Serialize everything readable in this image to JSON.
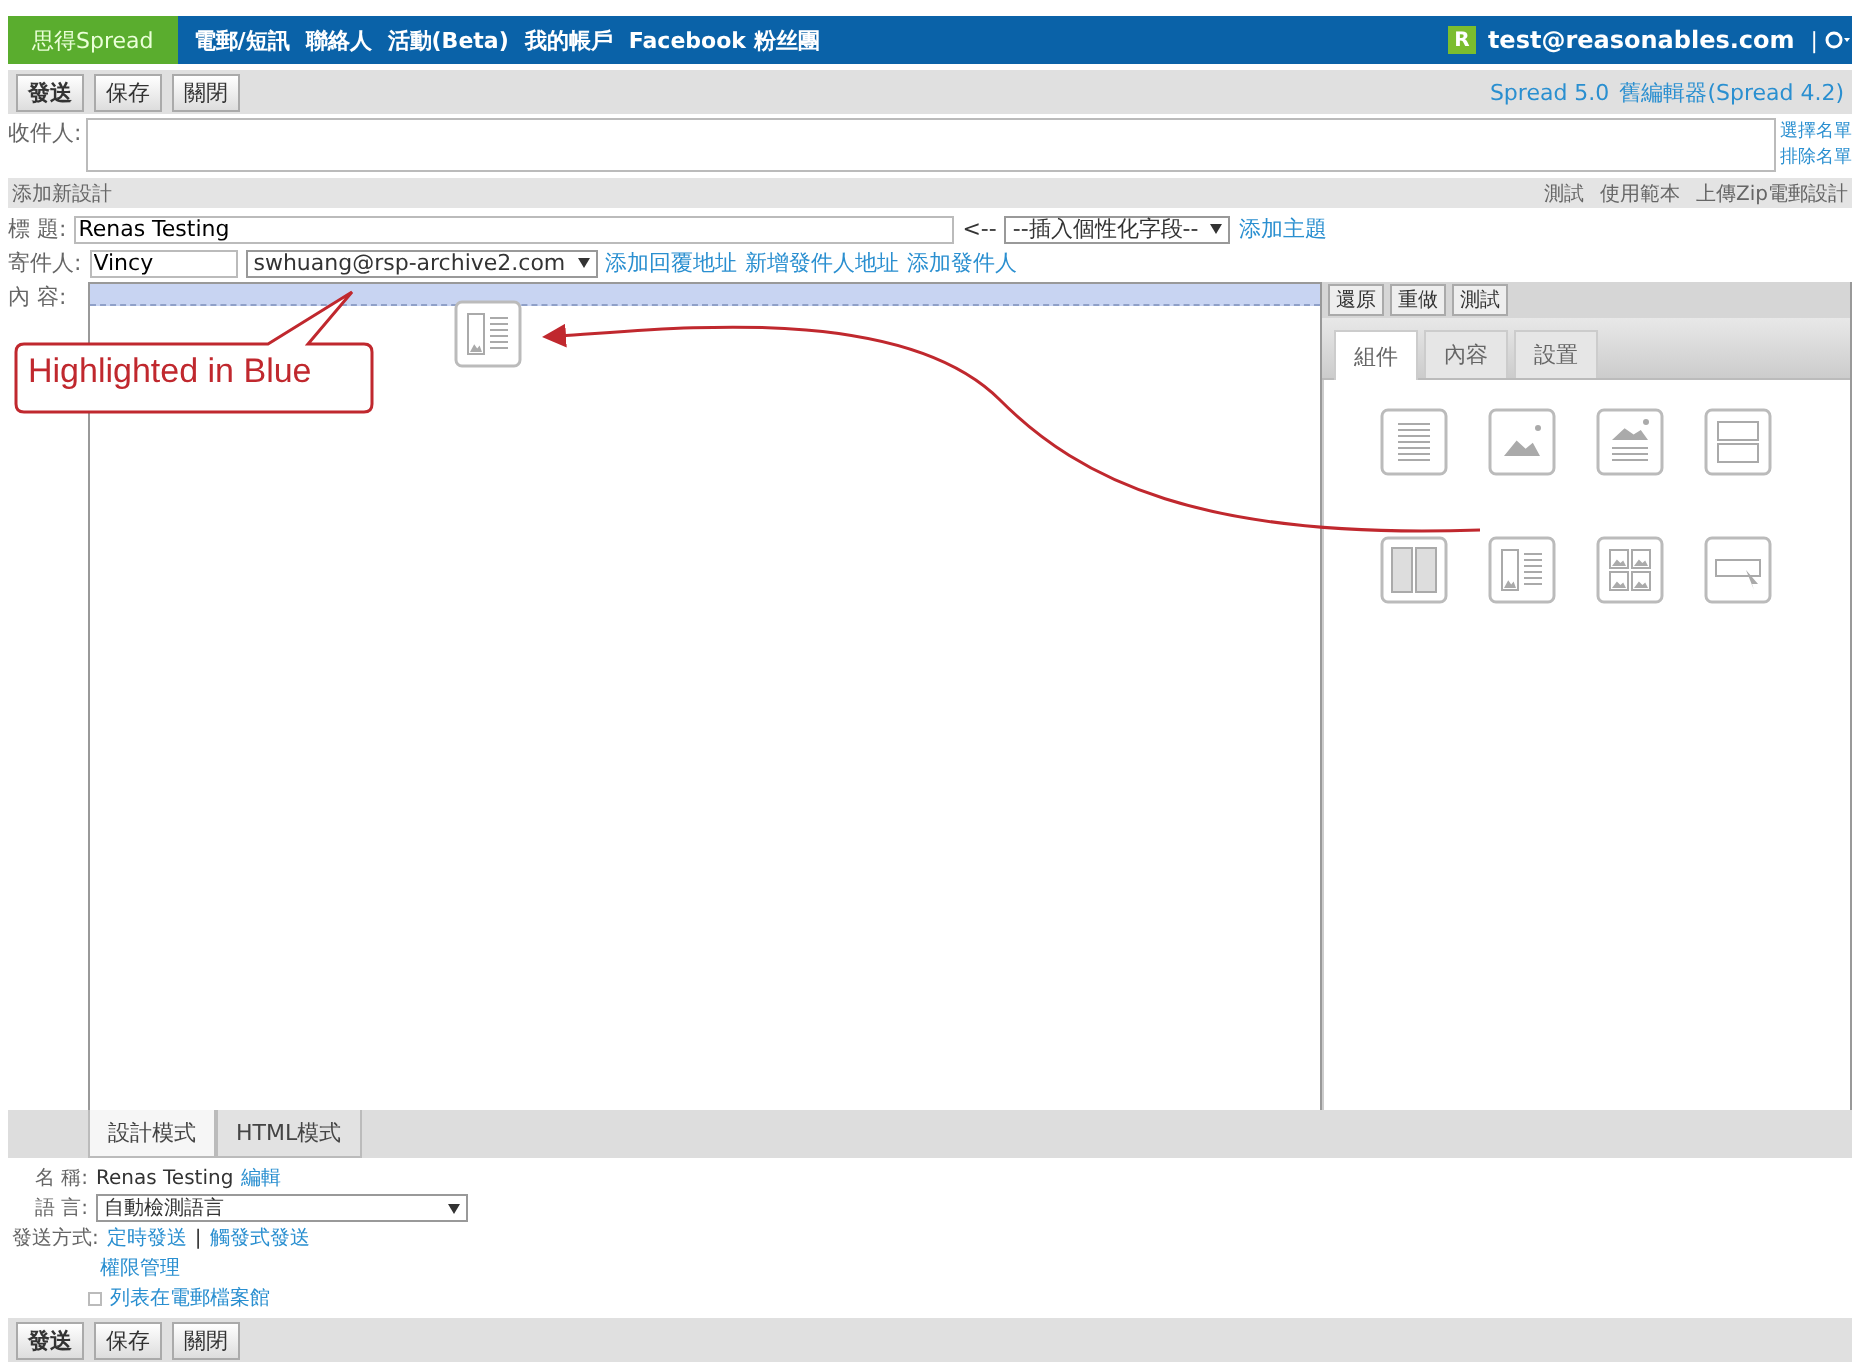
{
  "nav": {
    "brand": "思得Spread",
    "items": [
      "電郵/短訊",
      "聯絡人",
      "活動(Beta)",
      "我的帳戶",
      "Facebook 粉丝團"
    ],
    "account_badge": "R",
    "account": "test@reasonables.com",
    "separator": "|"
  },
  "toolbar": {
    "buttons": [
      "發送",
      "保存",
      "關閉"
    ],
    "links": [
      "Spread 5.0",
      "舊編輯器(Spread 4.2)"
    ]
  },
  "recipients": {
    "label": "收件人:",
    "links": [
      "選擇名單",
      "排除名單"
    ]
  },
  "section": {
    "title": "添加新設計",
    "actions": [
      "測試",
      "使用範本",
      "上傳Zip電郵設計"
    ]
  },
  "subject": {
    "label": "標 題:",
    "value": "Renas Testing",
    "arrow": "<--",
    "select": "--插入個性化字段--",
    "link": "添加主題"
  },
  "sender": {
    "label": "寄件人:",
    "name": "Vincy",
    "email": "swhuang@rsp-archive2.com",
    "links": [
      "添加回覆地址",
      "新增發件人地址",
      "添加發件人"
    ]
  },
  "content": {
    "label": "內 容:",
    "dropped_block": {
      "kind": "image-left-text"
    }
  },
  "editor_tools": [
    "還原",
    "重做",
    "測試"
  ],
  "panel_tabs": [
    {
      "label": "組件",
      "selected": true
    },
    {
      "label": "內容",
      "selected": false
    },
    {
      "label": "設置",
      "selected": false
    }
  ],
  "components": [
    {
      "kind": "text"
    },
    {
      "kind": "image"
    },
    {
      "kind": "image-text"
    },
    {
      "kind": "two-rows"
    },
    {
      "kind": "two-columns"
    },
    {
      "kind": "image-left-text"
    },
    {
      "kind": "image-grid"
    },
    {
      "kind": "button"
    }
  ],
  "mode_tabs": [
    {
      "label": "設計模式",
      "selected": true
    },
    {
      "label": "HTML模式",
      "selected": false
    }
  ],
  "footer": {
    "name_label": "名 稱:",
    "name": "Renas Testing",
    "name_link": "編輯",
    "language_label": "語 言:",
    "language": "自動檢測語言",
    "send_label": "發送方式:",
    "send_links": [
      "定時發送",
      "觸發式發送"
    ],
    "send_separator": "|",
    "permission_link": "權限管理",
    "archive": {
      "label": "列表在電郵檔案館",
      "checked": false
    }
  },
  "annotation": {
    "callout": "Highlighted in Blue"
  },
  "bottom_toolbar": {
    "buttons": [
      "發送",
      "保存",
      "關閉"
    ]
  }
}
